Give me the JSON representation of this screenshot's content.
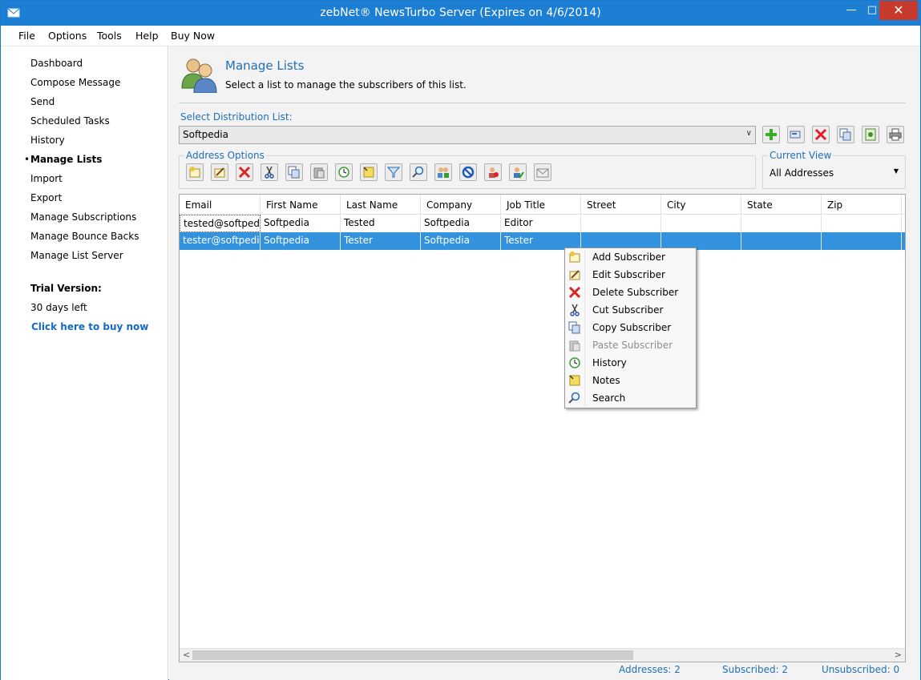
{
  "window": {
    "title": "zebNet® NewsTurbo Server (Expires on 4/6/2014)",
    "minimize": "—",
    "maximize": "□",
    "close": "✕"
  },
  "menu": [
    "File",
    "Options",
    "Tools",
    "Help",
    "Buy Now"
  ],
  "sidebar": {
    "items": [
      "Dashboard",
      "Compose Message",
      "Send",
      "Scheduled Tasks",
      "History",
      "Manage Lists",
      "Import",
      "Export",
      "Manage Subscriptions",
      "Manage Bounce Backs",
      "Manage List Server"
    ],
    "active_bullet": "•",
    "trial_label": "Trial Version:",
    "trial_days": "30 days left",
    "buy_link": "Click here to buy now"
  },
  "header": {
    "title": "Manage Lists",
    "subtitle": "Select a list to manage the subscribers of this list."
  },
  "distribution": {
    "label": "Select Distribution List:",
    "value": "Softpedia",
    "arrow": "∨"
  },
  "address_options": {
    "label": "Address Options"
  },
  "current_view": {
    "label": "Current View",
    "value": "All Addresses",
    "arrow": "▼"
  },
  "grid": {
    "columns": [
      "Email",
      "First Name",
      "Last Name",
      "Company",
      "Job Title",
      "Street",
      "City",
      "State",
      "Zip"
    ],
    "rows": [
      [
        "tested@softped...",
        "Softpedia",
        "Tested",
        "Softpedia",
        "Editor"
      ],
      [
        "tester@softpedi...",
        "Softpedia",
        "Tester",
        "Softpedia",
        "Tester"
      ]
    ],
    "scroll_left": "<",
    "scroll_right": ">"
  },
  "status": {
    "addresses": "Addresses: 2",
    "subscribed": "Subscribed: 2",
    "unsubscribed": "Unsubscribed: 0"
  },
  "context_menu": {
    "items": [
      {
        "label": "Add Subscriber",
        "icon": "add-subscriber-icon",
        "enabled": true
      },
      {
        "label": "Edit Subscriber",
        "icon": "edit-subscriber-icon",
        "enabled": true
      },
      {
        "label": "Delete Subscriber",
        "icon": "delete-subscriber-icon",
        "enabled": true
      },
      {
        "label": "Cut Subscriber",
        "icon": "cut-icon",
        "enabled": true
      },
      {
        "label": "Copy Subscriber",
        "icon": "copy-icon",
        "enabled": true
      },
      {
        "label": "Paste Subscriber",
        "icon": "paste-icon",
        "enabled": false
      },
      {
        "label": "History",
        "icon": "history-icon",
        "enabled": true
      },
      {
        "label": "Notes",
        "icon": "notes-icon",
        "enabled": true
      },
      {
        "label": "Search",
        "icon": "search-icon",
        "enabled": true
      }
    ]
  },
  "colors": {
    "titlebar": "#1c7fd3",
    "accent": "#1f6fb8",
    "selection": "#3393df",
    "close": "#c7392b"
  }
}
